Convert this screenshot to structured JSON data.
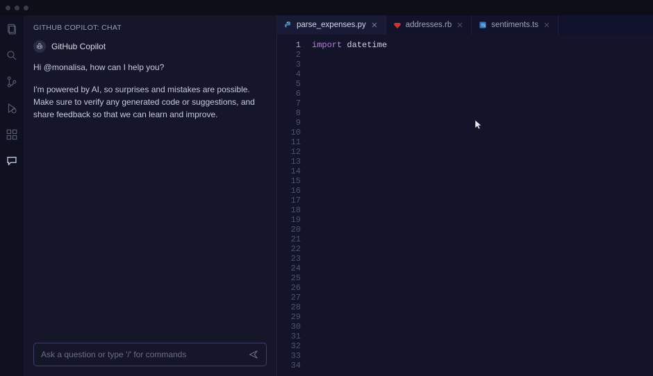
{
  "chat": {
    "header": "GITHUB COPILOT: CHAT",
    "bot_name": "GitHub Copilot",
    "greeting": "Hi @monalisa, how can I help you?",
    "disclaimer": "I'm powered by AI, so surprises and mistakes are possible. Make sure to verify any generated code or suggestions, and share feedback so that we can learn and improve.",
    "input_placeholder": "Ask a question or type '/' for commands"
  },
  "tabs": [
    {
      "label": "parse_expenses.py",
      "active": true
    },
    {
      "label": "addresses.rb",
      "active": false
    },
    {
      "label": "sentiments.ts",
      "active": false
    }
  ],
  "editor": {
    "line_count": 34,
    "lines": [
      {
        "tokens": [
          {
            "t": "import ",
            "c": "kw"
          },
          {
            "t": "datetime",
            "c": "ident"
          }
        ]
      }
    ]
  }
}
